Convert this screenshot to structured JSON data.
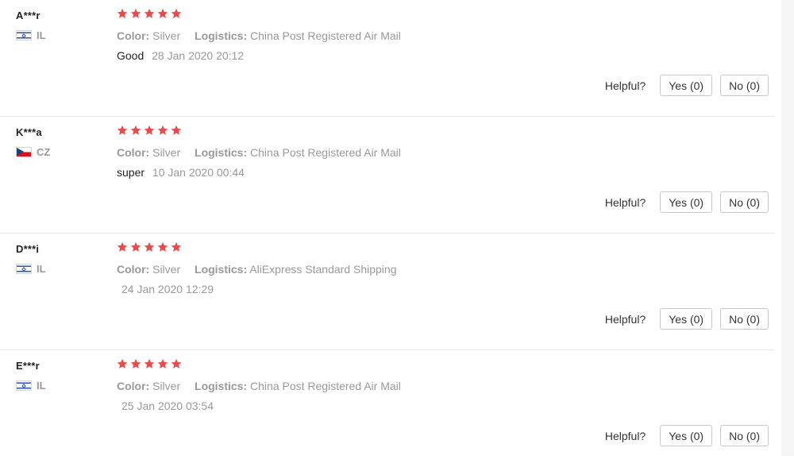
{
  "colors": {
    "star": "#f04848",
    "muted_text": "#999999",
    "flag_il_blue": "#2b4fb8",
    "flag_cz_blue": "#11457e",
    "flag_cz_red": "#d7141a"
  },
  "reviews": [
    {
      "user": "A***r",
      "country_code": "IL",
      "flag_icon": "israel-flag-icon",
      "rating": 5,
      "color_label": "Color:",
      "color_value": "Silver",
      "logistics_label": "Logistics:",
      "logistics_value": "China Post Registered Air Mail",
      "text": "Good",
      "date": "28 Jan 2020 20:12",
      "helpful_label": "Helpful?",
      "yes_label": "Yes (0)",
      "no_label": "No (0)"
    },
    {
      "user": "K***a",
      "country_code": "CZ",
      "flag_icon": "czech-flag-icon",
      "rating": 5,
      "color_label": "Color:",
      "color_value": "Silver",
      "logistics_label": "Logistics:",
      "logistics_value": "China Post Registered Air Mail",
      "text": "super",
      "date": "10 Jan 2020 00:44",
      "helpful_label": "Helpful?",
      "yes_label": "Yes (0)",
      "no_label": "No (0)"
    },
    {
      "user": "D***i",
      "country_code": "IL",
      "flag_icon": "israel-flag-icon",
      "rating": 5,
      "color_label": "Color:",
      "color_value": "Silver",
      "logistics_label": "Logistics:",
      "logistics_value": "AliExpress Standard Shipping",
      "text": "",
      "date": "24 Jan 2020 12:29",
      "helpful_label": "Helpful?",
      "yes_label": "Yes (0)",
      "no_label": "No (0)"
    },
    {
      "user": "E***r",
      "country_code": "IL",
      "flag_icon": "israel-flag-icon",
      "rating": 5,
      "color_label": "Color:",
      "color_value": "Silver",
      "logistics_label": "Logistics:",
      "logistics_value": "China Post Registered Air Mail",
      "text": "",
      "date": "25 Jan 2020 03:54",
      "helpful_label": "Helpful?",
      "yes_label": "Yes (0)",
      "no_label": "No (0)"
    }
  ]
}
